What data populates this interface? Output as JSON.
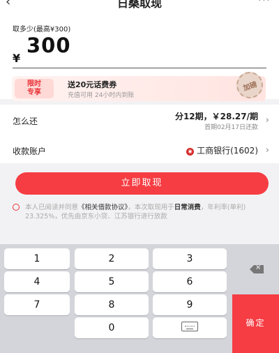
{
  "nav": {
    "back_icon": "chevron-left-icon",
    "title": "日桑取现",
    "more_label": "···"
  },
  "amount": {
    "label": "取多少(最高¥300)",
    "currency": "¥",
    "value": "300"
  },
  "promo": {
    "tag_line1": "限时",
    "tag_line2": "专享",
    "title": "送20元话费券",
    "subtitle": "充值可用 24小时内到账",
    "stamp": "加磅"
  },
  "repay": {
    "label": "怎么还",
    "plan": "分12期，￥28.27/期",
    "first_date": "首期02月17日还款"
  },
  "account": {
    "label": "收款账户",
    "bank_icon": "icbc-logo-icon",
    "bank": "工商银行(1602)"
  },
  "withdraw_button": "立即取现",
  "agreement": {
    "prefix": "本人已阅读并同意",
    "doc": "《相关借款协议》",
    "mid": "，本次取现用于",
    "purpose": "日常消费",
    "rest": "，年利率(单利) 23.325%，优先由京东小贷、江苏银行进行放款"
  },
  "keypad": {
    "keys": [
      "1",
      "2",
      "3",
      "4",
      "5",
      "6",
      "7",
      "8",
      "9",
      "0"
    ],
    "delete_icon": "backspace-icon",
    "hide_icon": "keyboard-hide-icon",
    "confirm": "确定"
  }
}
